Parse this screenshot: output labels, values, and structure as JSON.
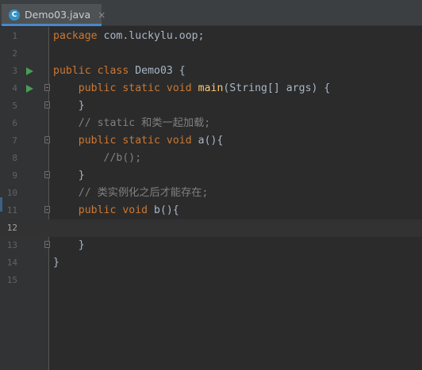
{
  "tab": {
    "label": "Demo03.java",
    "icon_letter": "C",
    "close": "×"
  },
  "editor": {
    "current_line": 12,
    "lines": [
      {
        "n": "1",
        "tokens": [
          [
            "kw",
            "package "
          ],
          [
            "p",
            "com.luckylu.oop;"
          ]
        ]
      },
      {
        "n": "2",
        "tokens": []
      },
      {
        "n": "3",
        "run": true,
        "tokens": [
          [
            "kw",
            "public class "
          ],
          [
            "p",
            "Demo03 {"
          ]
        ]
      },
      {
        "n": "4",
        "run": true,
        "fold": true,
        "tokens": [
          [
            "p",
            "    "
          ],
          [
            "kw",
            "public static void "
          ],
          [
            "fn",
            "main"
          ],
          [
            "p",
            "(String[] args) {"
          ]
        ]
      },
      {
        "n": "5",
        "fold": true,
        "tokens": [
          [
            "p",
            "    }"
          ]
        ]
      },
      {
        "n": "6",
        "tokens": [
          [
            "p",
            "    "
          ],
          [
            "cm",
            "// static 和类一起加载;"
          ]
        ]
      },
      {
        "n": "7",
        "fold": true,
        "tokens": [
          [
            "p",
            "    "
          ],
          [
            "kw",
            "public static void "
          ],
          [
            "p",
            "a(){"
          ]
        ]
      },
      {
        "n": "8",
        "tokens": [
          [
            "p",
            "        "
          ],
          [
            "cm",
            "//b();"
          ]
        ]
      },
      {
        "n": "9",
        "fold": true,
        "tokens": [
          [
            "p",
            "    }"
          ]
        ]
      },
      {
        "n": "10",
        "tokens": [
          [
            "p",
            "    "
          ],
          [
            "cm",
            "// 类实例化之后才能存在;"
          ]
        ]
      },
      {
        "n": "11",
        "fold": true,
        "tokens": [
          [
            "p",
            "    "
          ],
          [
            "kw",
            "public void "
          ],
          [
            "p",
            "b(){"
          ]
        ]
      },
      {
        "n": "12",
        "tokens": []
      },
      {
        "n": "13",
        "fold": true,
        "tokens": [
          [
            "p",
            "    }"
          ]
        ]
      },
      {
        "n": "14",
        "tokens": [
          [
            "p",
            "}"
          ]
        ]
      },
      {
        "n": "15",
        "tokens": []
      }
    ]
  },
  "colors": {
    "background": "#2b2b2b",
    "keyword": "#cc7832",
    "method": "#ffc66d",
    "comment": "#808080",
    "plain": "#a9b7c6",
    "run_icon": "#499c54"
  }
}
